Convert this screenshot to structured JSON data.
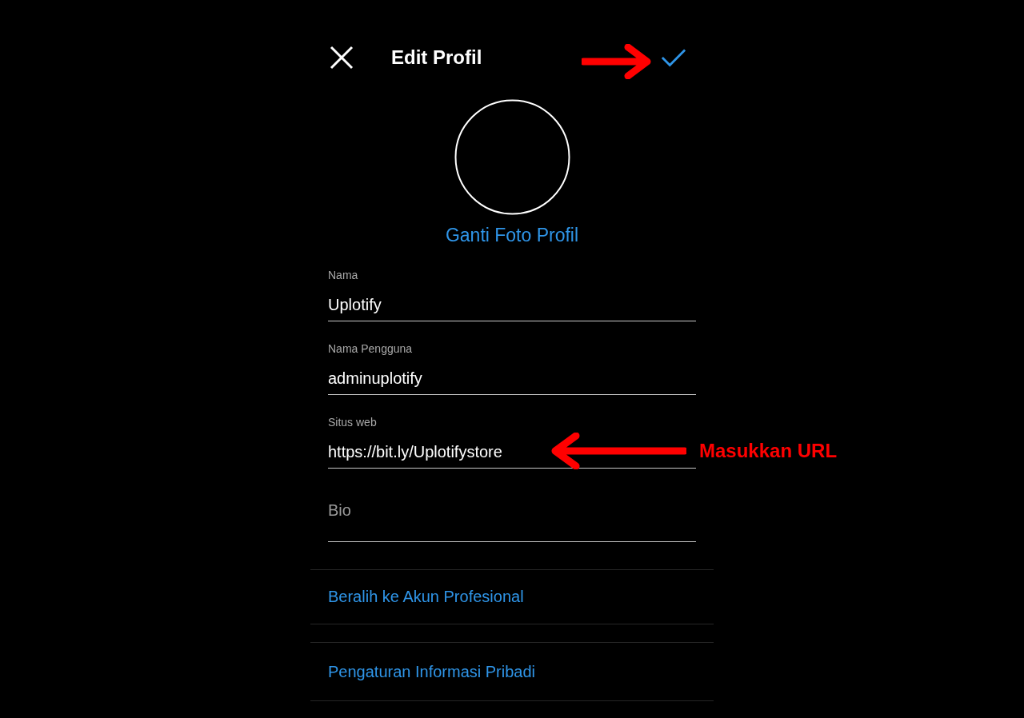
{
  "header": {
    "title": "Edit Profil"
  },
  "profile_photo": {
    "change_label": "Ganti Foto Profil"
  },
  "fields": [
    {
      "label": "Nama",
      "value": "Uplotify"
    },
    {
      "label": "Nama Pengguna",
      "value": "adminuplotify"
    },
    {
      "label": "Situs web",
      "value": "https://bit.ly/Uplotifystore"
    },
    {
      "placeholder": "Bio"
    }
  ],
  "links": [
    "Beralih ke Akun Profesional",
    "Pengaturan Informasi Pribadi"
  ],
  "annotation": {
    "text": "Masukkan URL"
  }
}
